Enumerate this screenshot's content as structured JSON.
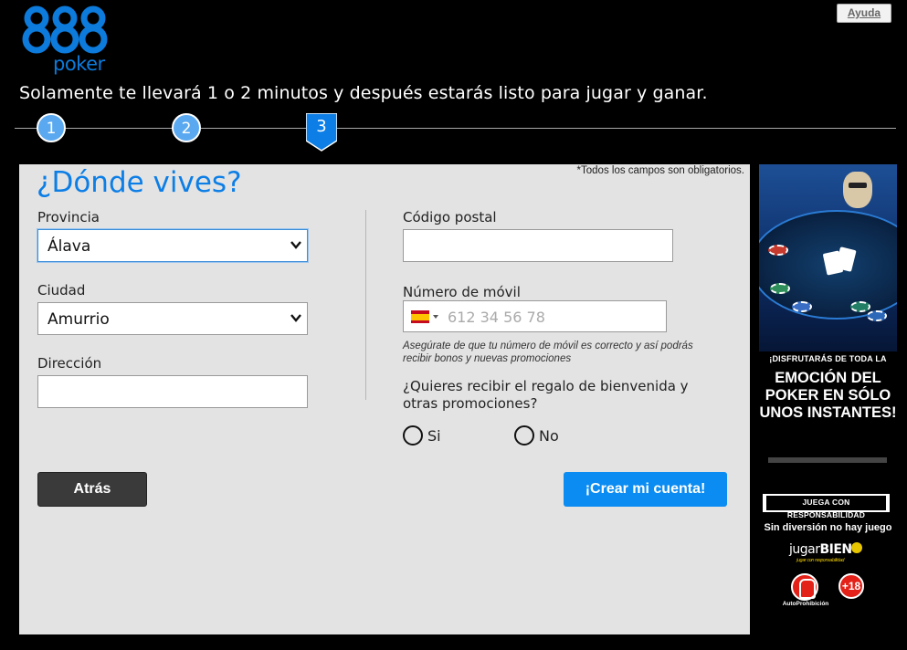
{
  "brand": {
    "logo_number": "888",
    "logo_word": "poker",
    "color": "#0c7bdc"
  },
  "header": {
    "help_label": "Ayuda",
    "tagline": "Solamente te llevará 1 o 2 minutos y después estarás listo para jugar y ganar."
  },
  "stepper": {
    "steps": [
      {
        "label": "1",
        "state": "done"
      },
      {
        "label": "2",
        "state": "done"
      },
      {
        "label": "3",
        "state": "active"
      }
    ]
  },
  "form": {
    "title": "¿Dónde vives?",
    "required_note": "*Todos los campos son obligatorios.",
    "province": {
      "label": "Provincia",
      "value": "Álava"
    },
    "city": {
      "label": "Ciudad",
      "value": "Amurrio"
    },
    "address": {
      "label": "Dirección",
      "value": ""
    },
    "postal": {
      "label": "Código postal",
      "value": ""
    },
    "mobile": {
      "label": "Número de móvil",
      "placeholder": "612 34 56 78",
      "country_flag": "spain-flag-icon"
    },
    "mobile_hint": "Asegúrate de que tu número de móvil es correcto y así podrás recibir bonos y nuevas promociones",
    "promo_question": "¿Quieres recibir el regalo de bienvenida y otras promociones?",
    "promo_options": [
      "Si",
      "No"
    ],
    "back_label": "Atrás",
    "create_label": "¡Crear mi cuenta!"
  },
  "ad": {
    "small_text": "¡DISFRUTARÁS DE TODA LA",
    "big_text": "EMOCIÓN DEL POKER EN SÓLO UNOS INSTANTES!"
  },
  "responsible": {
    "badge": "JUEGA CON RESPONSABILIDAD",
    "tagline": "Sin diversión no hay juego",
    "jugar_light": "jugar",
    "jugar_bold": "BIEN",
    "jugar_sub": "jugar con responsabilidad",
    "auto_label": "AutoProhibición",
    "age_label": "+18"
  },
  "colors": {
    "accent": "#0c7ee6",
    "create_button": "#0a8cf2",
    "back_button": "#3a3a3a",
    "panel": "#e3e3e3"
  }
}
